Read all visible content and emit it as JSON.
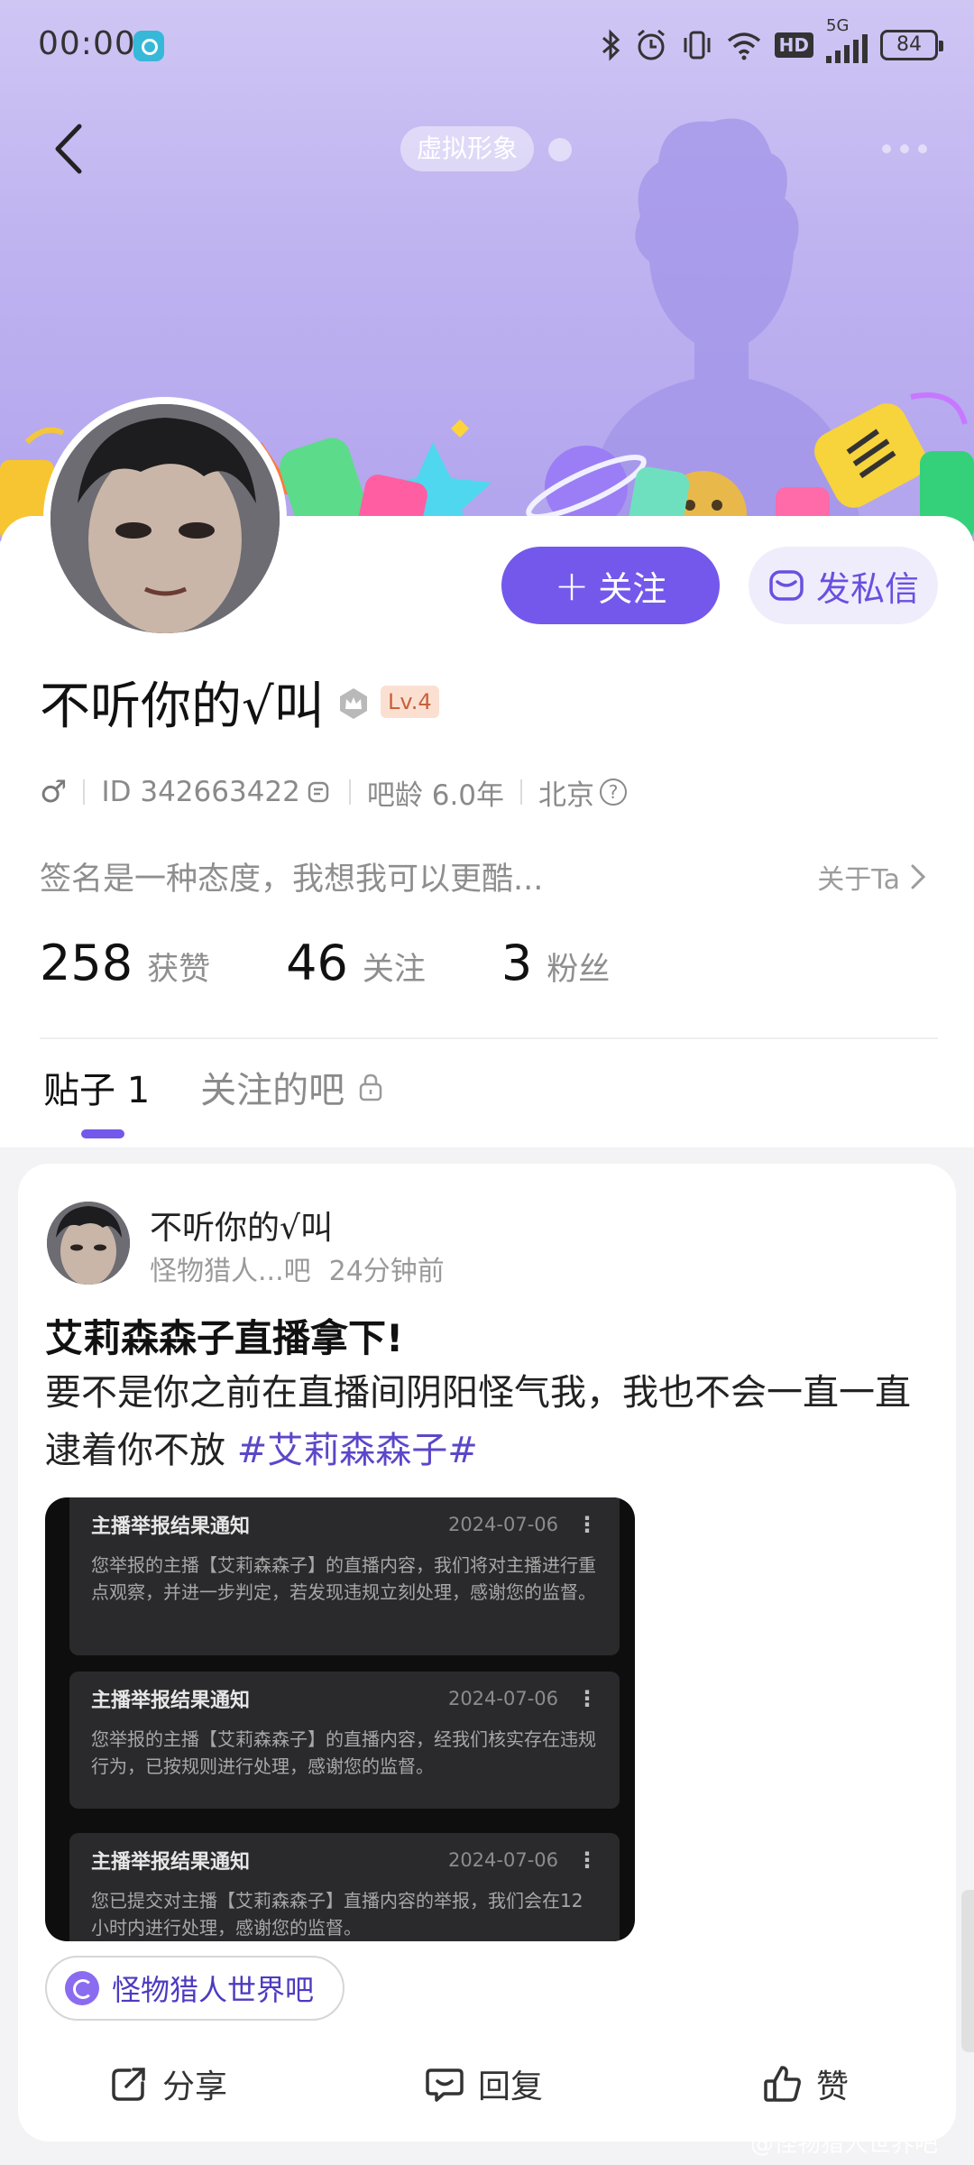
{
  "status_bar": {
    "time": "00:00",
    "battery": "84",
    "network": "5G",
    "hd": "HD"
  },
  "header": {
    "avatar_chip": "虚拟形象"
  },
  "profile": {
    "follow_label": "关注",
    "message_label": "发私信",
    "name": "不听你的√叫",
    "level": "Lv.4",
    "gender": "♂",
    "id_text": "ID 342663422",
    "bar_age": "吧龄 6.0年",
    "location": "北京",
    "signature": "签名是一种态度，我想我可以更酷...",
    "about_label": "关于Ta",
    "stats": [
      {
        "num": "258",
        "label": "获赞"
      },
      {
        "num": "46",
        "label": "关注"
      },
      {
        "num": "3",
        "label": "粉丝"
      }
    ]
  },
  "tabs": [
    {
      "label": "贴子 1"
    },
    {
      "label": "关注的吧"
    }
  ],
  "post": {
    "author": "不听你的√叫",
    "forum": "怪物猎人...吧",
    "time": "24分钟前",
    "title": "艾莉森森子直播拿下!",
    "body": "要不是你之前在直播间阴阳怪气我，我也不会一直一直逮着你不放 ",
    "hashtag": "#艾莉森森子#",
    "notices": [
      {
        "title": "主播举报结果通知",
        "date": "2024-07-06",
        "text": "您举报的主播【艾莉森森子】的直播内容，我们将对主播进行重点观察，并进一步判定，若发现违规立刻处理，感谢您的监督。"
      },
      {
        "title": "主播举报结果通知",
        "date": "2024-07-06",
        "text": "您举报的主播【艾莉森森子】的直播内容，经我们核实存在违规行为，已按规则进行处理，感谢您的监督。"
      },
      {
        "title": "主播举报结果通知",
        "date": "2024-07-06",
        "text": "您已提交对主播【艾莉森森子】直播内容的举报，我们会在12小时内进行处理，感谢您的监督。"
      }
    ],
    "forum_tag": "怪物猎人世界吧",
    "actions": {
      "share": "分享",
      "reply": "回复",
      "like": "赞"
    }
  },
  "watermark": "@怪物猎人世界吧",
  "colors": {
    "accent": "#7458EC",
    "banner": "#BFB3F0",
    "hashtag": "#5B47C9"
  }
}
